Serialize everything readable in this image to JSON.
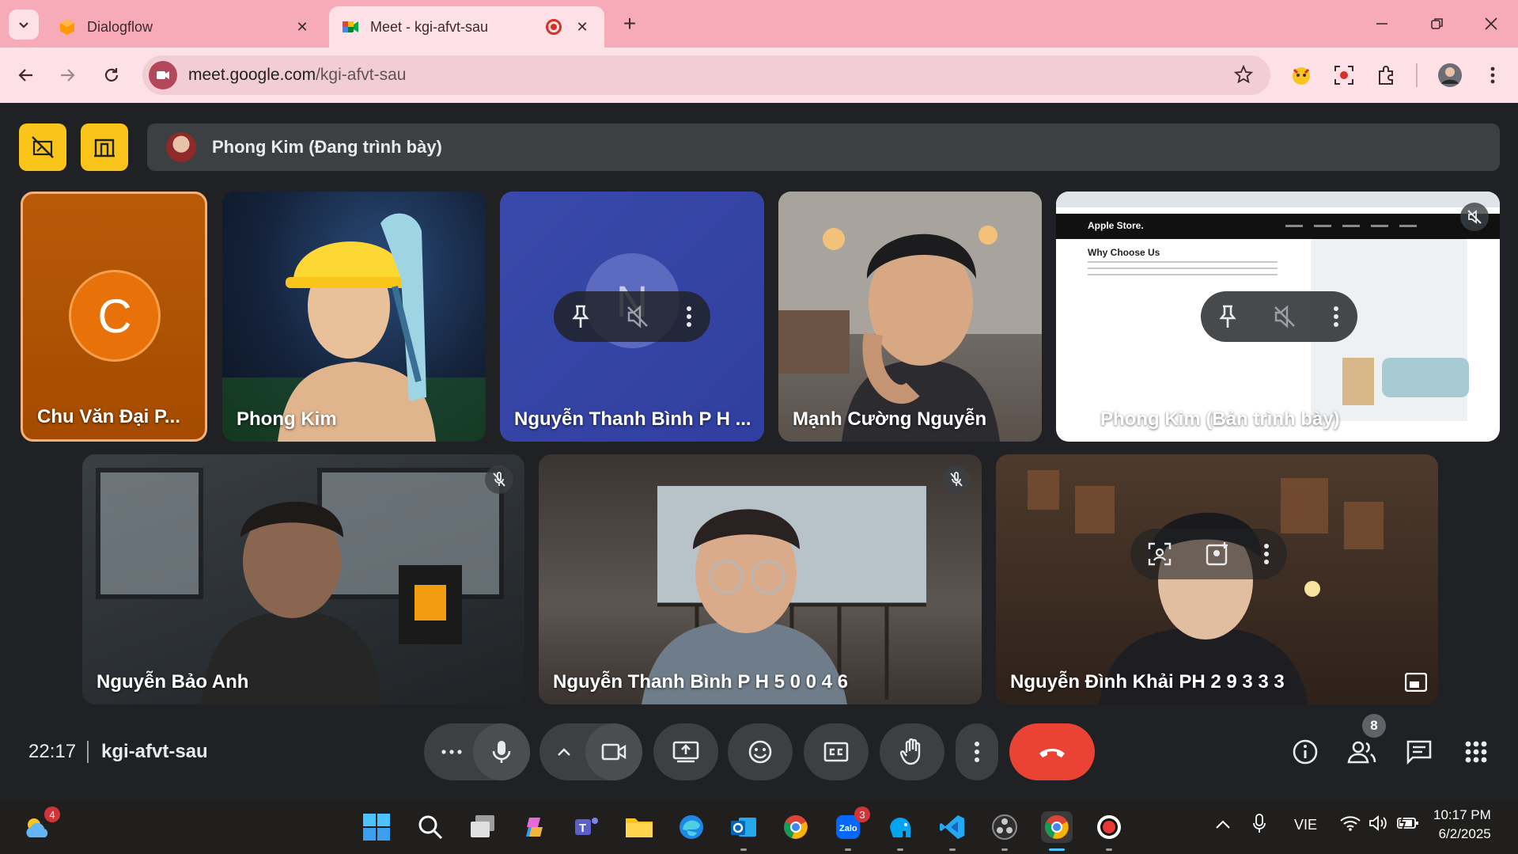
{
  "browser": {
    "tabs": [
      {
        "label": "Dialogflow",
        "active": false
      },
      {
        "label": "Meet - kgi-afvt-sau",
        "active": true
      }
    ],
    "url_host": "meet.google.com",
    "url_path": "/kgi-afvt-sau"
  },
  "meet": {
    "presenting_banner": "Phong Kim (Đang trình bày)",
    "tiles": [
      {
        "name": "Chu Văn Đại P...",
        "avatar_letter": "C"
      },
      {
        "name": "Phong Kim"
      },
      {
        "name": "Nguyễn Thanh Bình P H ...",
        "avatar_letter": "N"
      },
      {
        "name": "Mạnh Cường Nguyễn"
      },
      {
        "name": "Phong Kim (Bản trình bày)"
      },
      {
        "name": "Nguyễn Bảo Anh"
      },
      {
        "name": "Nguyễn Thanh Bình P H 5 0 0 4 6"
      },
      {
        "name": "Nguyễn Đình Khải PH 2 9 3 3 3"
      }
    ],
    "shared_screen": {
      "brand": "Apple Store.",
      "heading": "Why Choose Us"
    },
    "clock": "22:17",
    "meeting_code": "kgi-afvt-sau",
    "participants_count": "8"
  },
  "taskbar": {
    "weather_badge": "4",
    "zalo_badge": "3",
    "language": "VIE",
    "time": "10:17 PM",
    "date": "6/2/2025"
  },
  "colors": {
    "tab_strip": "#f7aab8",
    "toolbar": "#fde1e7",
    "accent_yellow": "#f9c51a",
    "end_call": "#ea4335",
    "stage_bg": "#202124"
  }
}
